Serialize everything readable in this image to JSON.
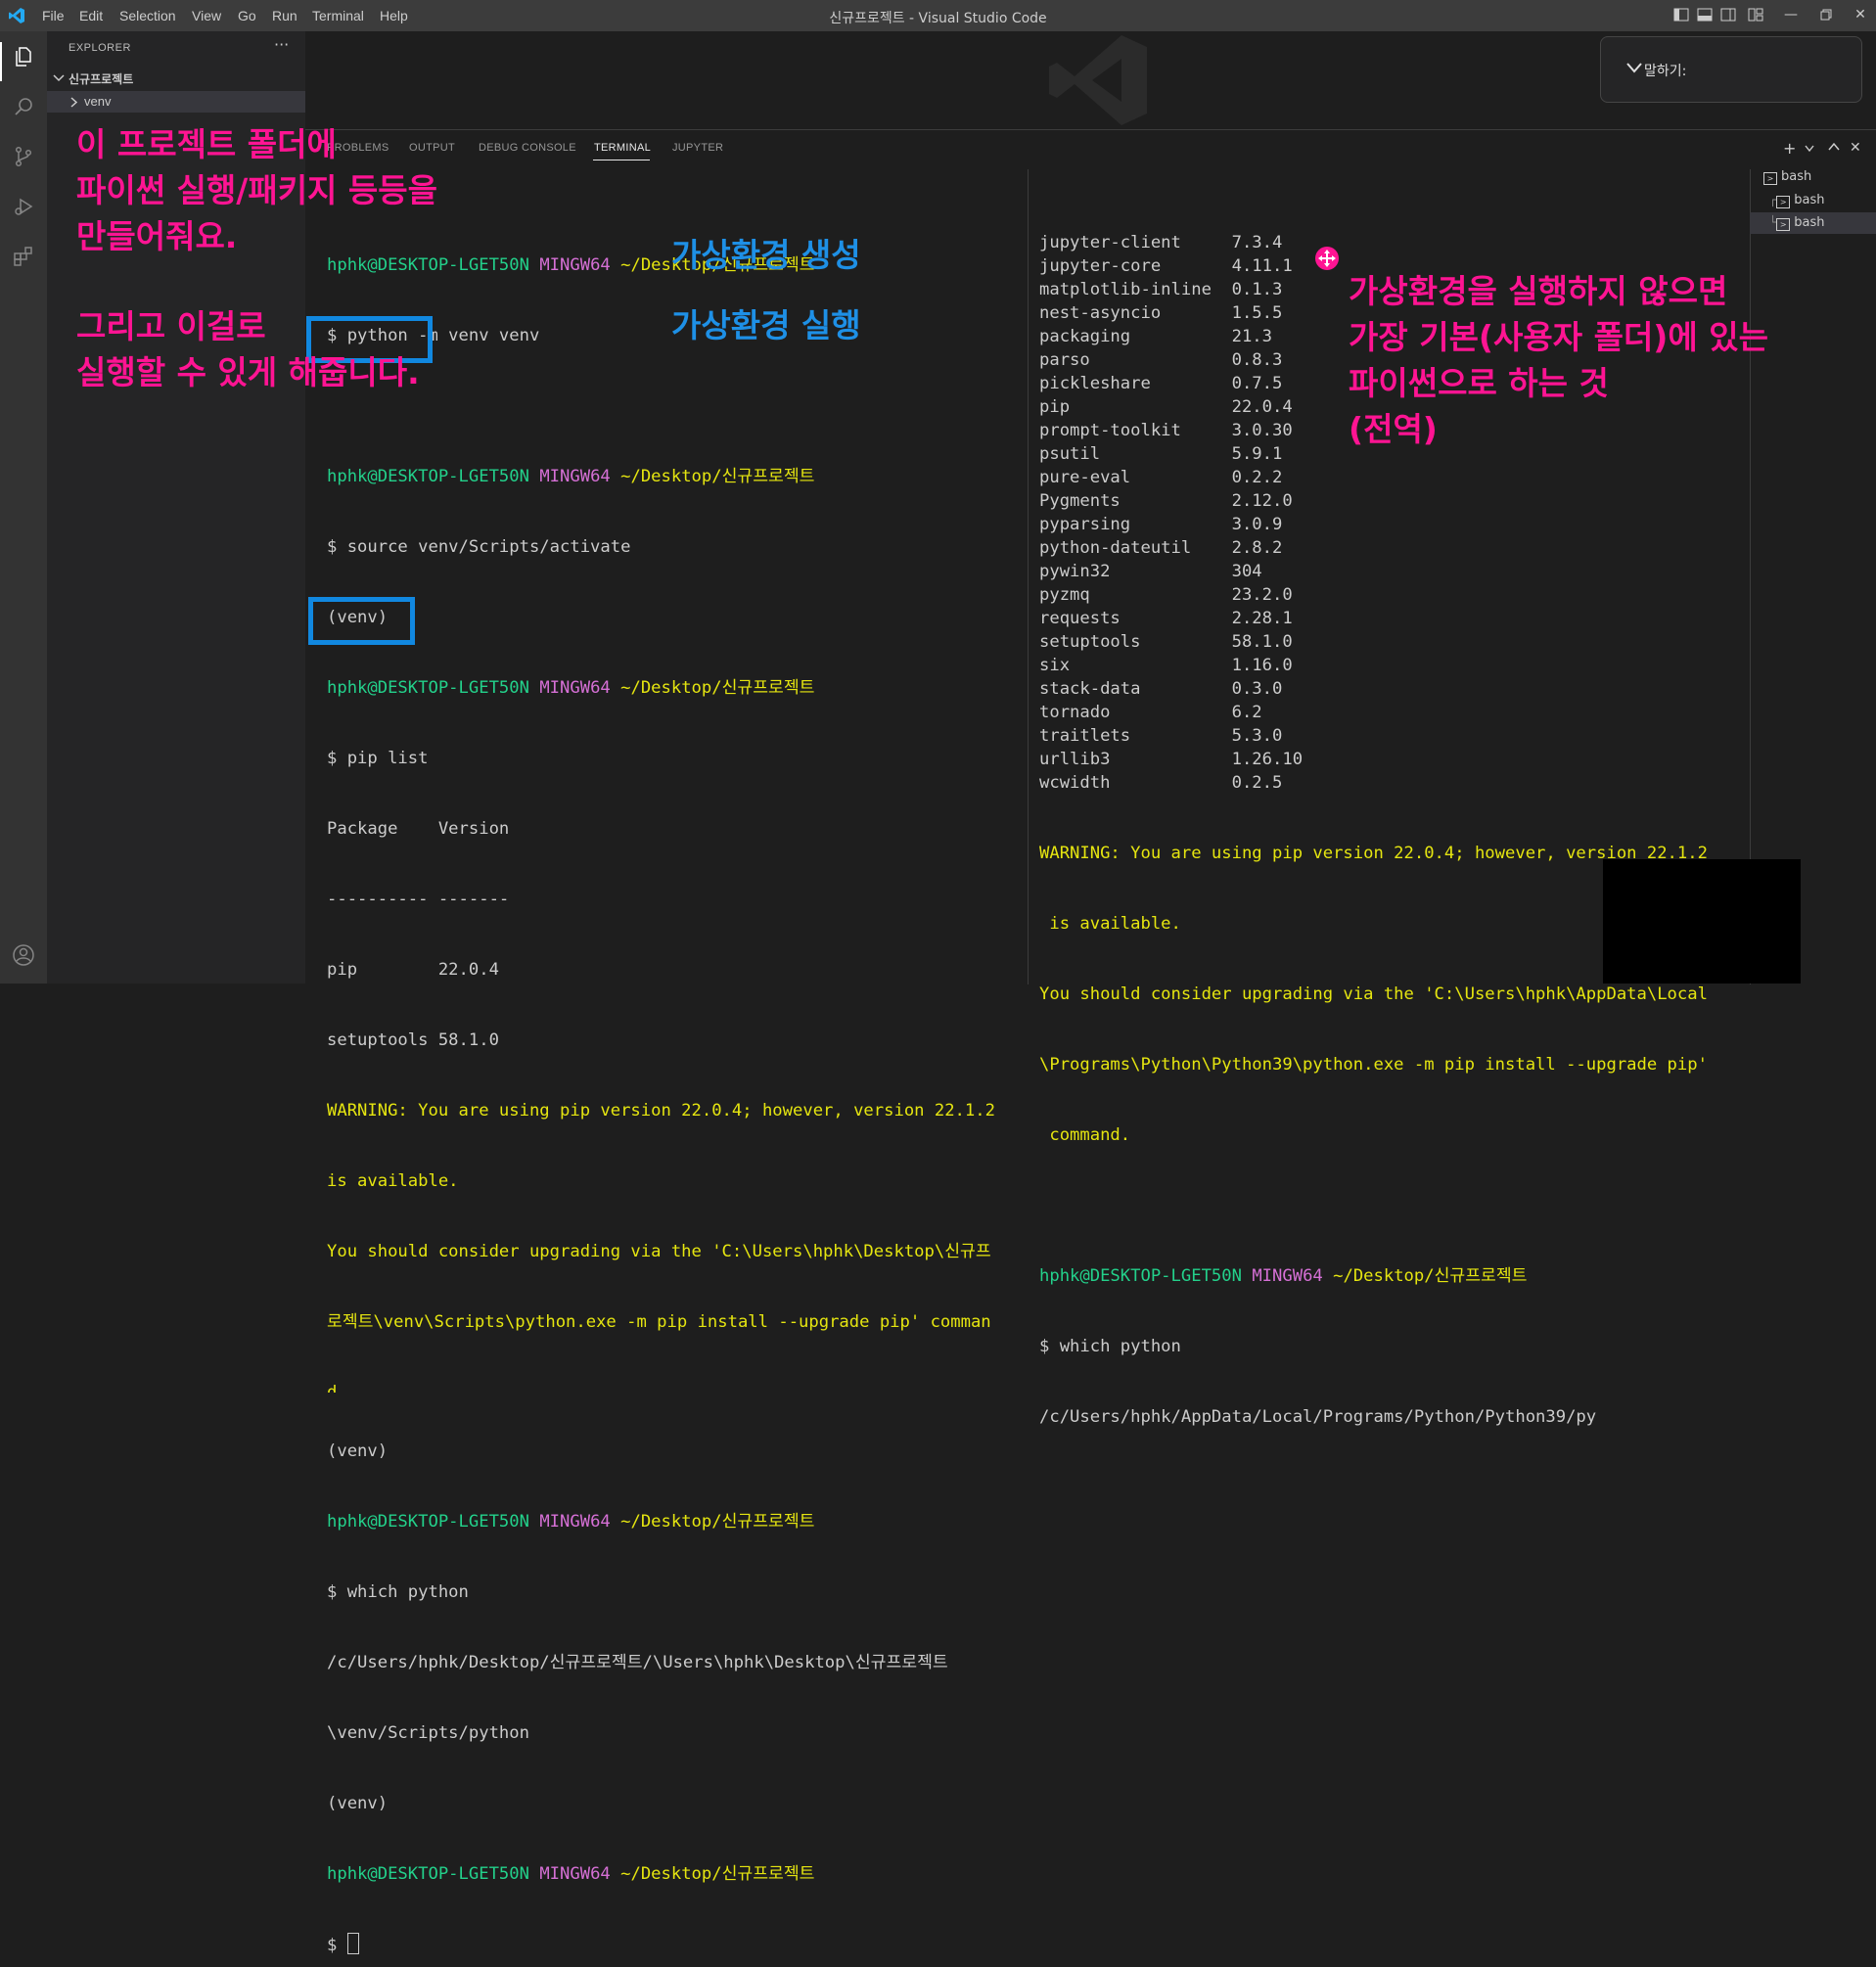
{
  "titlebar": {
    "menu": [
      "File",
      "Edit",
      "Selection",
      "View",
      "Go",
      "Run",
      "Terminal",
      "Help"
    ],
    "title": "신규프로젝트 - Visual Studio Code"
  },
  "sidebar": {
    "title": "EXPLORER",
    "more": "···",
    "folder": "신규프로젝트",
    "items": [
      {
        "label": "venv"
      }
    ]
  },
  "voice": {
    "label": "말하기:"
  },
  "panel": {
    "tabs": [
      "PROBLEMS",
      "OUTPUT",
      "DEBUG CONSOLE",
      "TERMINAL",
      "JUPYTER"
    ],
    "active_tab": "TERMINAL",
    "terminals": [
      "bash",
      "bash",
      "bash"
    ]
  },
  "colors": {
    "prompt_user": "#23d18b",
    "prompt_env": "#d670d6",
    "prompt_path": "#e5e510",
    "annotation_pink": "#ff1493",
    "annotation_blue": "#1e90e6"
  },
  "prompt": {
    "user": "hphk@DESKTOP-LGET50N",
    "env": "MINGW64",
    "path": "~/Desktop/신규프로젝트"
  },
  "terminal_left": {
    "cmd1": "$ python -m venv venv",
    "cmd2": "$ source venv/Scripts/activate",
    "venv1": "(venv)",
    "cmd3": "$ pip list",
    "header": "Package    Version",
    "sep": "---------- -------",
    "pkg1": "pip        22.0.4",
    "pkg2": "setuptools 58.1.0",
    "warn1": "WARNING: You are using pip version 22.0.4; however, version 22.1.2",
    "warn2": "is available.",
    "warn3": "You should consider upgrading via the 'C:\\Users\\hphk\\Desktop\\신규프",
    "warn4": "로젝트\\venv\\Scripts\\python.exe -m pip install --upgrade pip' comman",
    "warn5": "d.",
    "venv2": "(venv)",
    "cmd4": "$ which python",
    "out1": "/c/Users/hphk/Desktop/신규프로젝트/\\Users\\hphk\\Desktop\\신규프로젝트",
    "out2": "\\venv/Scripts/python",
    "venv3": "(venv)",
    "cursor_prompt": "$ "
  },
  "terminal_right": {
    "packages": [
      "jupyter-client     7.3.4",
      "jupyter-core       4.11.1",
      "matplotlib-inline  0.1.3",
      "nest-asyncio       1.5.5",
      "packaging          21.3",
      "parso              0.8.3",
      "pickleshare        0.7.5",
      "pip                22.0.4",
      "prompt-toolkit     3.0.30",
      "psutil             5.9.1",
      "pure-eval          0.2.2",
      "Pygments           2.12.0",
      "pyparsing          3.0.9",
      "python-dateutil    2.8.2",
      "pywin32            304",
      "pyzmq              23.2.0",
      "requests           2.28.1",
      "setuptools         58.1.0",
      "six                1.16.0",
      "stack-data         0.3.0",
      "tornado            6.2",
      "traitlets          5.3.0",
      "urllib3            1.26.10",
      "wcwidth            0.2.5"
    ],
    "warn1": "WARNING: You are using pip version 22.0.4; however, version 22.1.2",
    "warn2": " is available.",
    "warn3": "You should consider upgrading via the 'C:\\Users\\hphk\\AppData\\Local",
    "warn4": "\\Programs\\Python\\Python39\\python.exe -m pip install --upgrade pip'",
    "warn5": " command.",
    "cmd": "$ which python",
    "out": "/c/Users/hphk/AppData/Local/Programs/Python/Python39/py"
  },
  "annotations": {
    "left_note_1": "이 프로젝트 폴더에\n파이썬 실행/패키지 등등을\n만들어줘요.",
    "left_note_2": "그리고 이걸로\n실행할 수 있게 해줍니다.",
    "create_label": "가상환경 생성",
    "run_label": "가상환경 실행",
    "right_note": "가상환경을 실행하지 않으면\n가장 기본(사용자 폴더)에 있는\n파이썬으로 하는 것\n(전역)"
  }
}
